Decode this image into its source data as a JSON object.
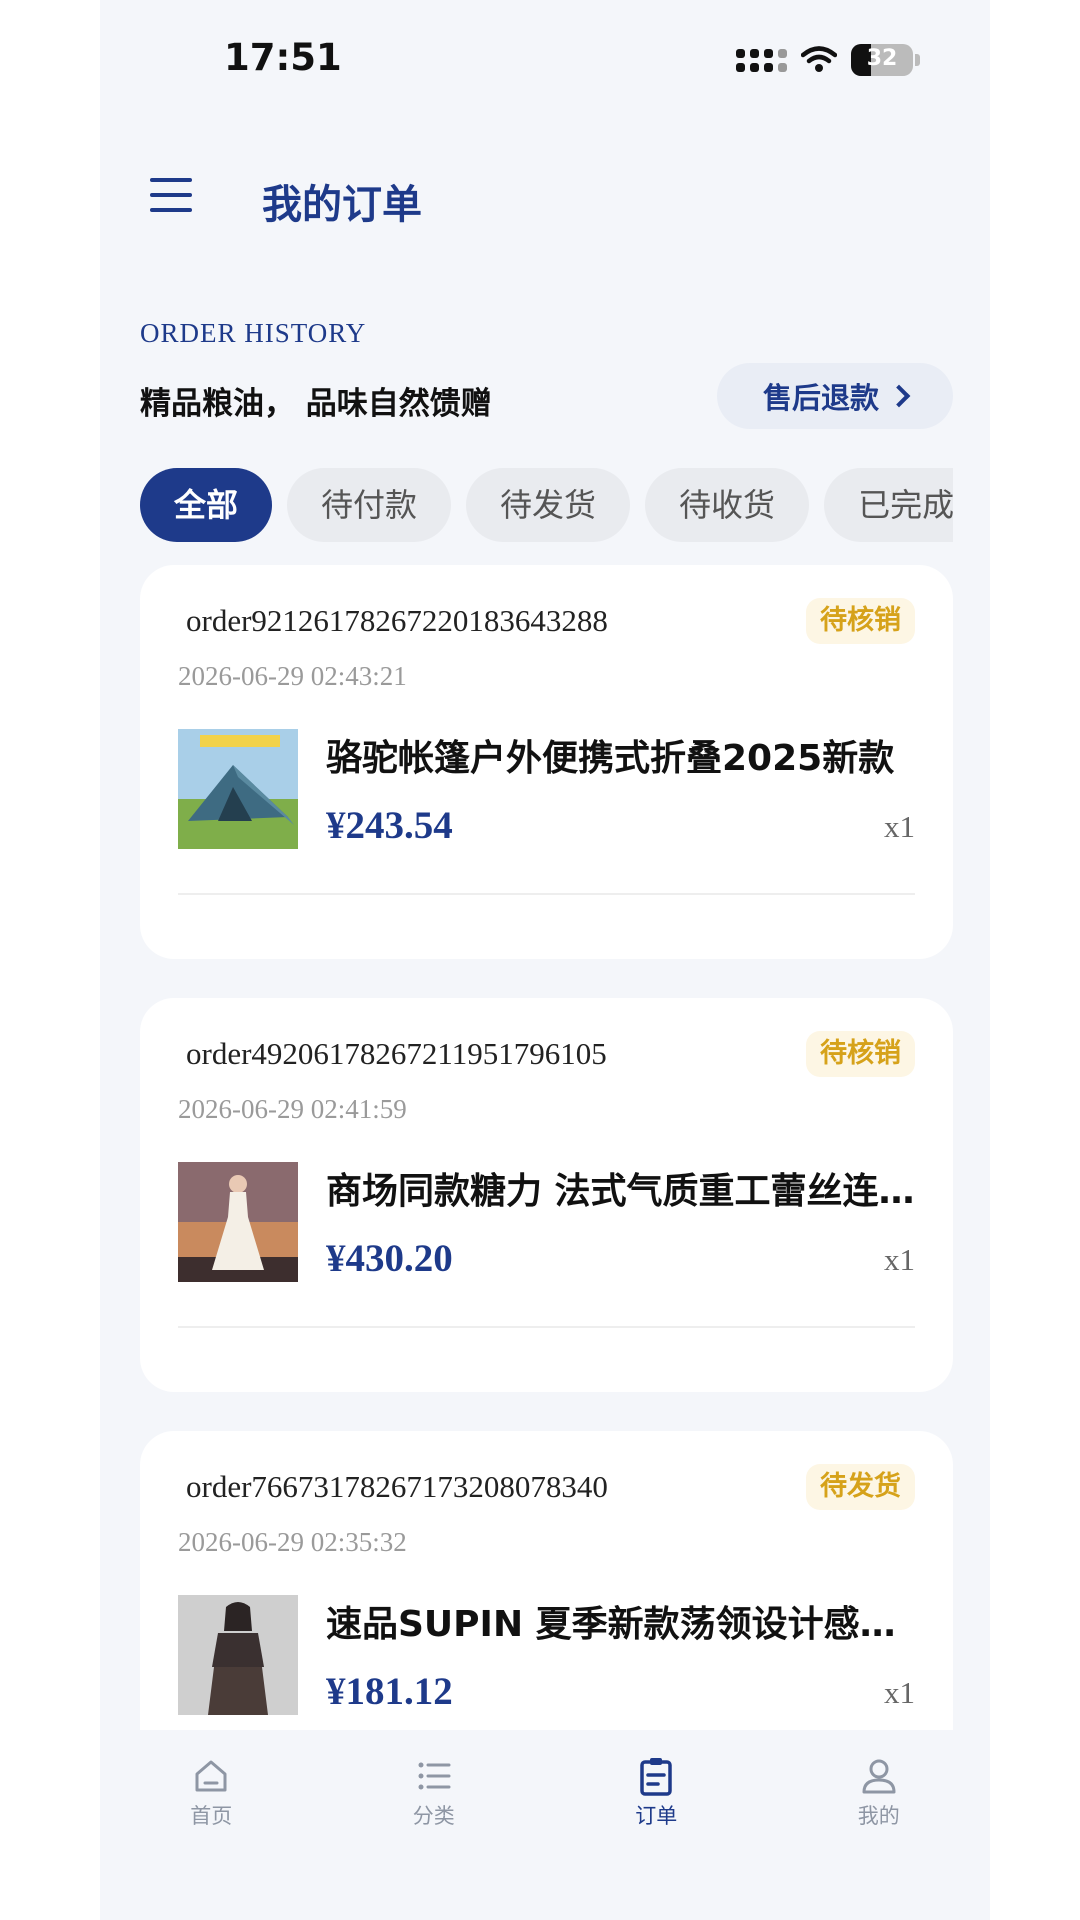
{
  "status_bar": {
    "time": "17:51",
    "battery": "32",
    "battery_level": 0.32
  },
  "header": {
    "title": "我的订单"
  },
  "hero": {
    "eyebrow": "ORDER HISTORY",
    "slogan": "精品粮油， 品味自然馈赠",
    "refund_label": "售后退款"
  },
  "tabs": [
    {
      "label": "全部",
      "active": true
    },
    {
      "label": "待付款",
      "active": false
    },
    {
      "label": "待发货",
      "active": false
    },
    {
      "label": "待收货",
      "active": false
    },
    {
      "label": "已完成",
      "active": false
    }
  ],
  "orders": [
    {
      "order_no": "order92126178267220183643288",
      "status": "待核销",
      "time": "2026-06-29 02:43:21",
      "product": "骆驼帐篷户外便携式折叠2025新款",
      "price": "¥243.54",
      "qty": "x1"
    },
    {
      "order_no": "order49206178267211951796105",
      "status": "待核销",
      "time": "2026-06-29 02:41:59",
      "product": "商场同款糖力 法式气质重工蕾丝连衣裙",
      "price": "¥430.20",
      "qty": "x1"
    },
    {
      "order_no": "order76673178267173208078340",
      "status": "待发货",
      "time": "2026-06-29 02:35:32",
      "product": "速品SUPIN 夏季新款荡领设计感上衣",
      "price": "¥181.12",
      "qty": "x1"
    }
  ],
  "bottom_nav": [
    {
      "label": "首页",
      "icon": "home-icon",
      "active": false
    },
    {
      "label": "分类",
      "icon": "list-icon",
      "active": false
    },
    {
      "label": "订单",
      "icon": "clipboard-icon",
      "active": true
    },
    {
      "label": "我的",
      "icon": "user-icon",
      "active": false
    }
  ],
  "colors": {
    "primary": "#1e3a8a",
    "badge_text": "#d6a21a",
    "badge_bg": "#fdf6e4",
    "background": "#f4f6fa"
  }
}
